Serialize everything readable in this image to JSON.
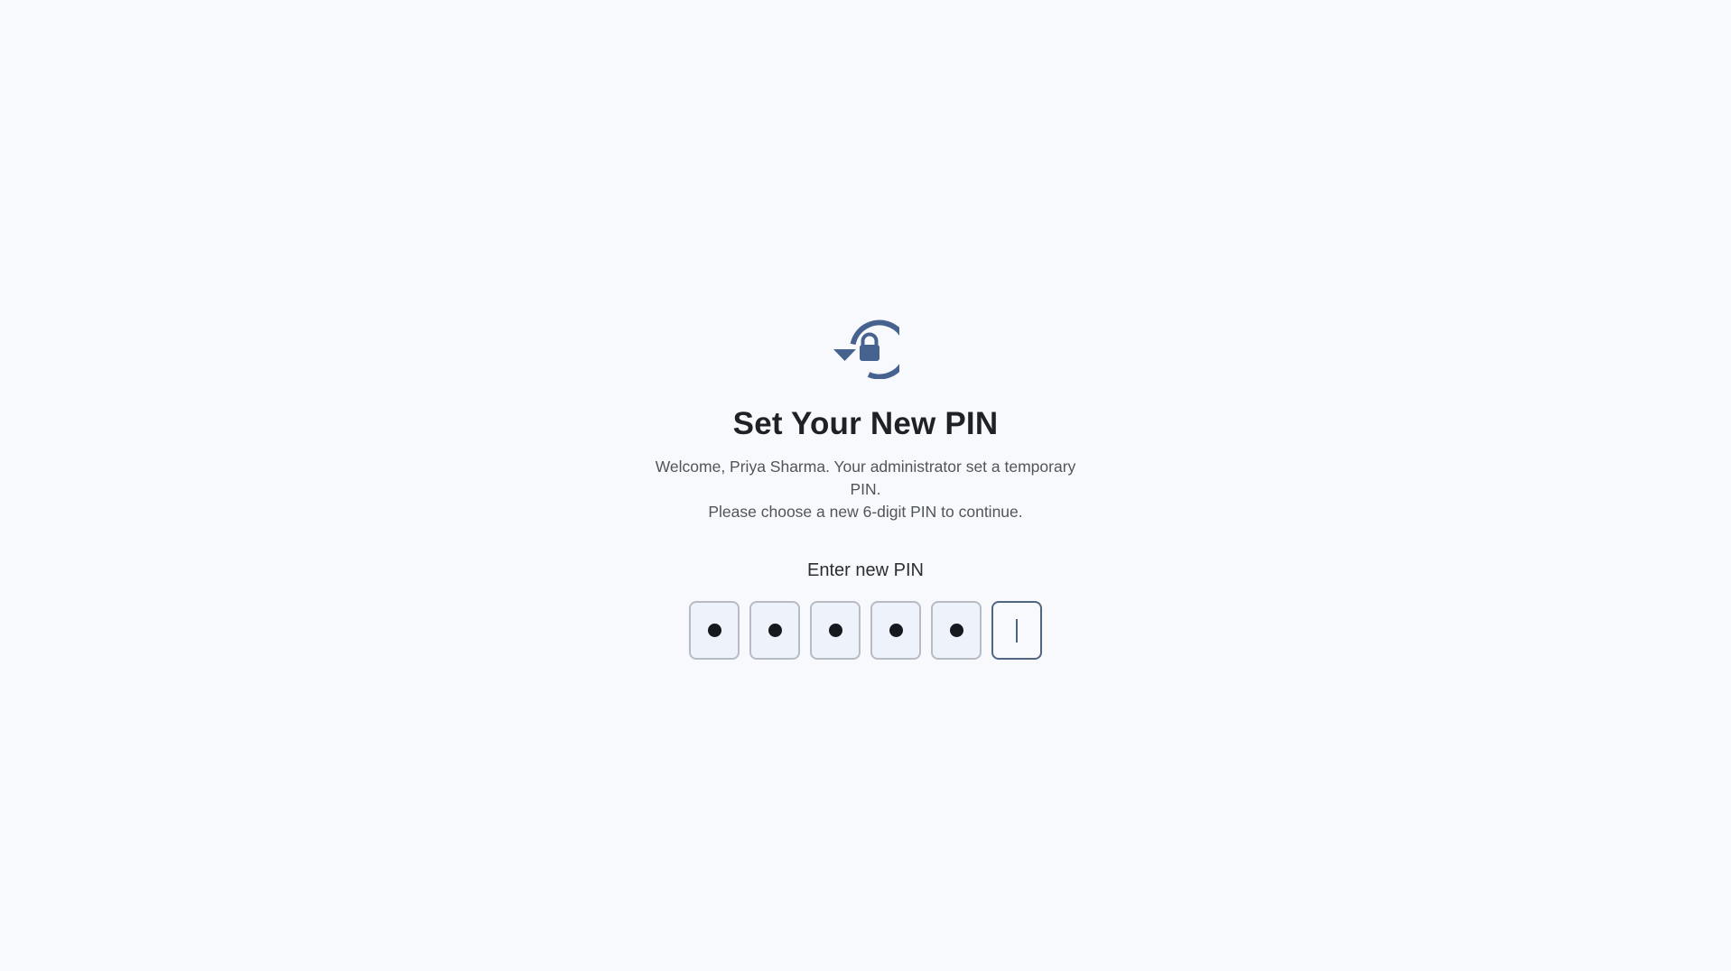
{
  "header": {
    "icon": "lock-reset-icon",
    "title": "Set Your New PIN",
    "subtitle_line1": "Welcome, Priya Sharma. Your administrator set a temporary PIN.",
    "subtitle_line2": "Please choose a new 6-digit PIN to continue."
  },
  "pin": {
    "label": "Enter new PIN",
    "length": 6,
    "filled_count": 5,
    "active_index": 5
  },
  "colors": {
    "accent": "#46628e",
    "background": "#f8f9fc",
    "title": "#1e2126",
    "box_fill": "#eef2fa",
    "box_border": "#b7bcc4",
    "active_border": "#4f6580"
  }
}
